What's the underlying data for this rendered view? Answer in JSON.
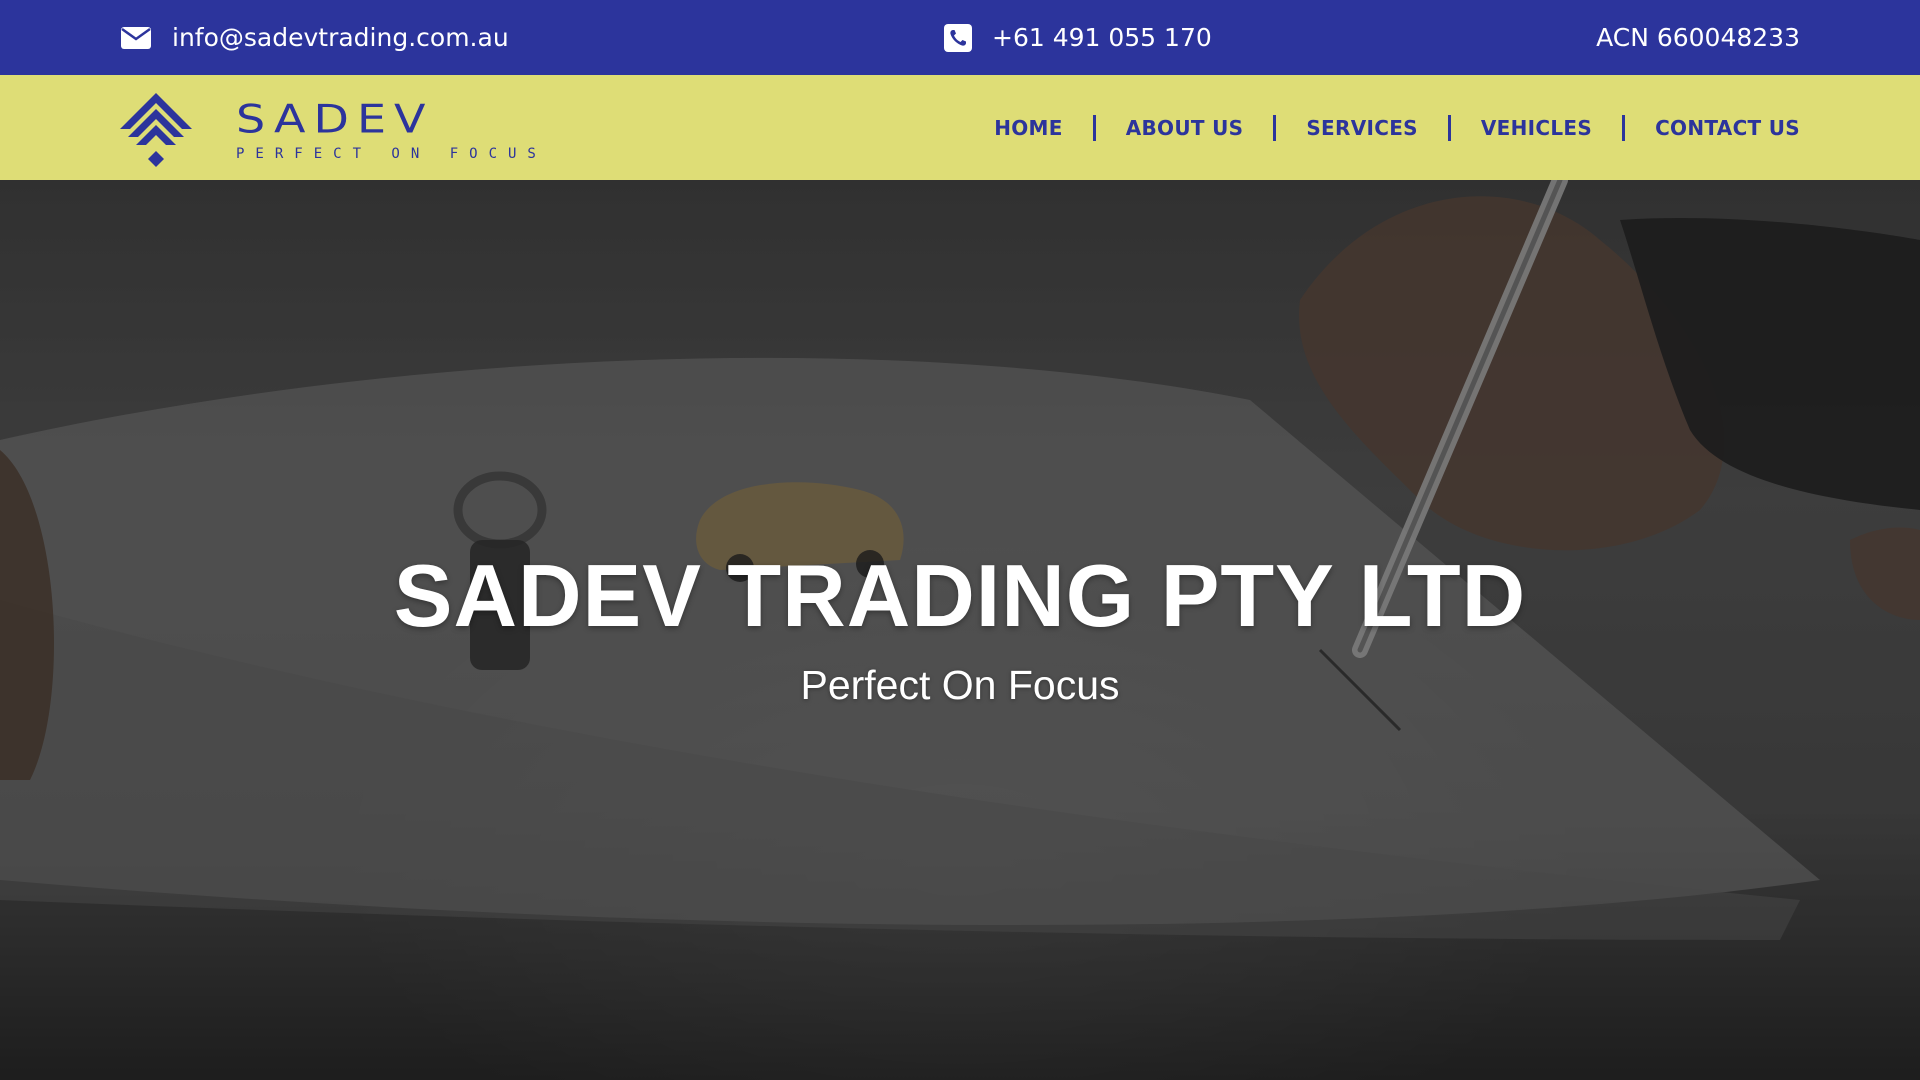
{
  "topbar": {
    "email": "info@sadevtrading.com.au",
    "phone": "+61 491 055 170",
    "acn": "ACN 660048233",
    "email_icon": "envelope-icon",
    "phone_icon": "phone-icon"
  },
  "logo": {
    "word": "SADEV",
    "tagline": "PERFECT ON FOCUS"
  },
  "nav": {
    "items": [
      {
        "label": "HOME"
      },
      {
        "label": "ABOUT US"
      },
      {
        "label": "SERVICES"
      },
      {
        "label": "VEHICLES"
      },
      {
        "label": "CONTACT US"
      }
    ]
  },
  "hero": {
    "title": "SADEV TRADING PTY LTD",
    "subtitle": "Perfect On Focus"
  },
  "colors": {
    "primary_blue": "#2c349c",
    "nav_yellow": "#dedd76",
    "text_white": "#ffffff"
  }
}
